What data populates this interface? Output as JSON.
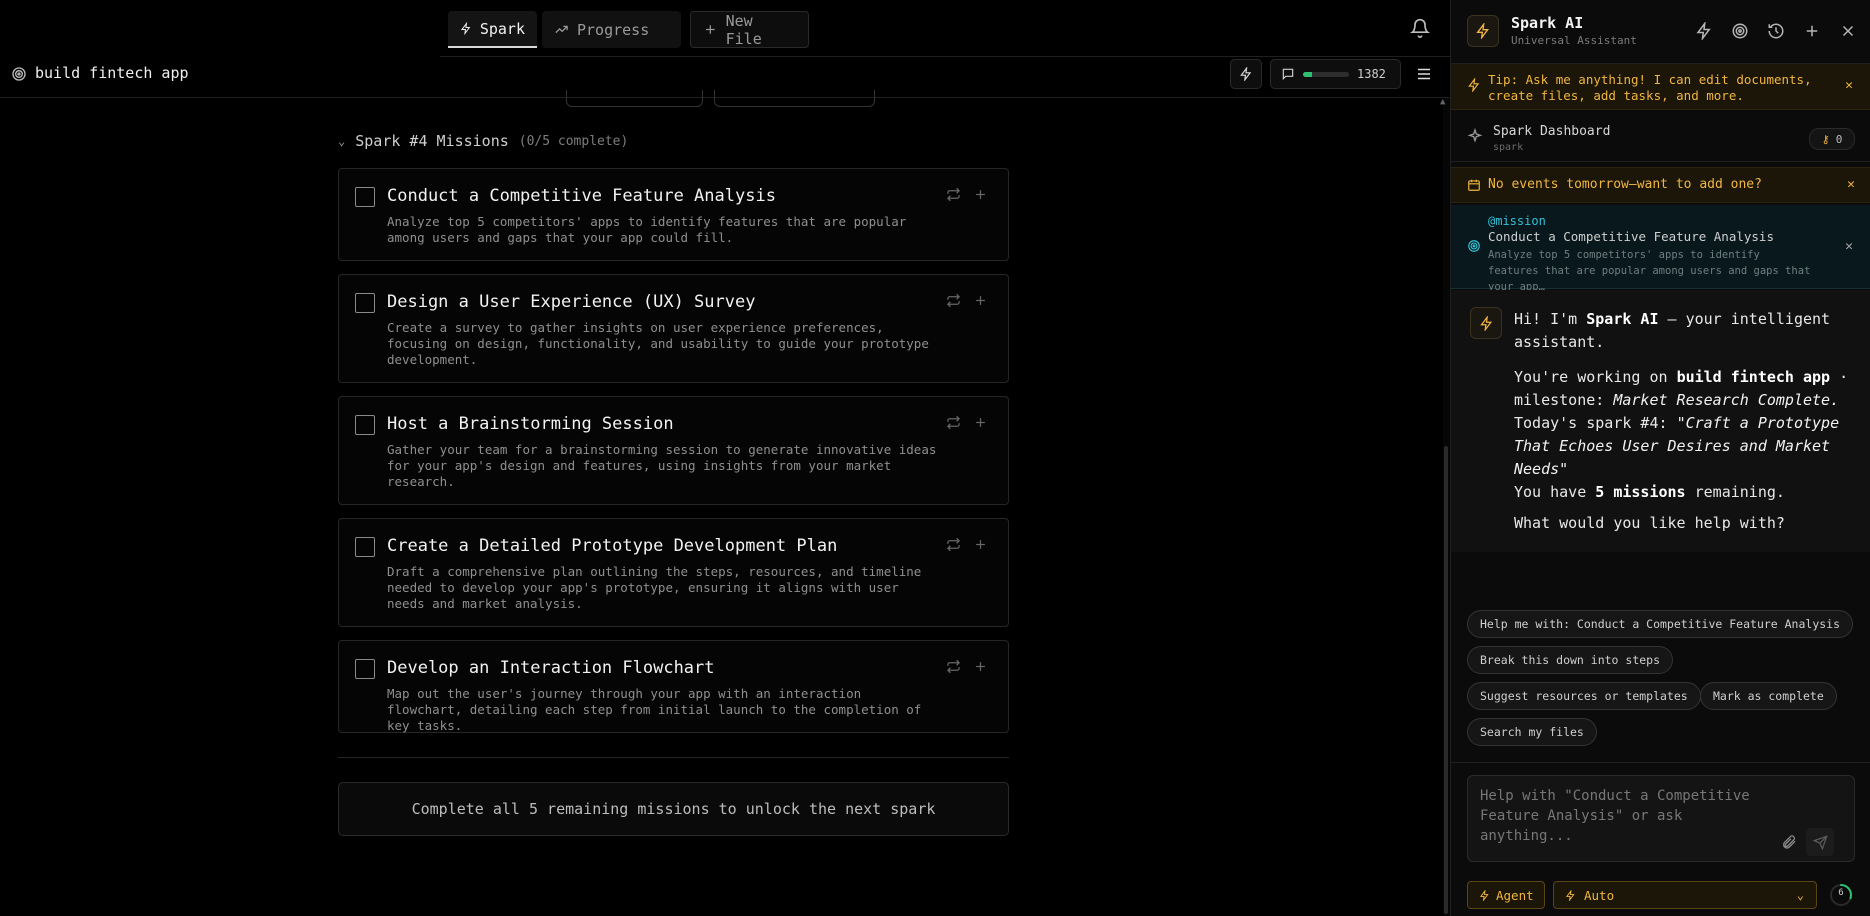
{
  "topnav": {
    "tabs": [
      {
        "label": "Spark"
      },
      {
        "label": "Progress"
      },
      {
        "label": "New File"
      }
    ]
  },
  "project": {
    "title": "build fintech app",
    "credits": "1382",
    "credits_fraction": 0.2
  },
  "missions_section": {
    "title": "Spark #4 Missions",
    "subtitle": "(0/5 complete)",
    "missions": [
      {
        "title": "Conduct a Competitive Feature Analysis",
        "desc": "Analyze top 5 competitors' apps to identify features that are popular among users and gaps that your app could fill."
      },
      {
        "title": "Design a User Experience (UX) Survey",
        "desc": "Create a survey to gather insights on user experience preferences, focusing on design, functionality, and usability to guide your prototype development."
      },
      {
        "title": "Host a Brainstorming Session",
        "desc": "Gather your team for a brainstorming session to generate innovative ideas for your app's design and features, using insights from your market research."
      },
      {
        "title": "Create a Detailed Prototype Development Plan",
        "desc": "Draft a comprehensive plan outlining the steps, resources, and timeline needed to develop your app's prototype, ensuring it aligns with user needs and market analysis."
      },
      {
        "title": "Develop an Interaction Flowchart",
        "desc": "Map out the user's journey through your app with an interaction flowchart, detailing each step from initial launch to the completion of key tasks."
      }
    ],
    "unlock_text": "Complete all 5 remaining missions to unlock the next spark"
  },
  "panel": {
    "title": "Spark AI",
    "subtitle": "Universal Assistant",
    "tip": "Tip: Ask me anything! I can edit documents, create files, add tasks, and more.",
    "dashboard": {
      "title": "Spark Dashboard",
      "sub": "spark",
      "badge": "0"
    },
    "events_text": "No events tomorrow—want to add one?",
    "context": {
      "tag": "@mission",
      "title": "Conduct a Competitive Feature Analysis",
      "desc": "Analyze top 5 competitors' apps to identify features that are popular among users and gaps that your app…"
    },
    "message": {
      "hi_prefix": "Hi! I'm ",
      "name": "Spark AI",
      "hi_suffix": " — your intelligent assistant.",
      "working_prefix": "You're working on ",
      "project": "build fintech app",
      "working_mid": " · milestone: ",
      "milestone": "Market Research Complete.",
      "today_prefix": "Today's spark #4: ",
      "spark_title": "\"Craft a Prototype That Echoes User Desires and Market Needs\"",
      "have_prefix": "You have ",
      "missions_count": "5 missions",
      "have_suffix": " remaining.",
      "question": "What would you like help with?"
    },
    "chips": [
      "Help me with: Conduct a Competitive Feature Analysis",
      "Break this down into steps",
      "Suggest resources or templates",
      "Mark as complete",
      "Search my files"
    ],
    "input_placeholder": "Help with \"Conduct a Competitive Feature Analysis\" or ask anything...",
    "agent_label": "Agent",
    "mode_label": "Auto",
    "ring_value": "6",
    "ring_fraction": 0.3
  },
  "colors": {
    "accent": "#f0b640",
    "mission_accent": "#33c1d6",
    "credit_bar": "#2fbf71"
  }
}
